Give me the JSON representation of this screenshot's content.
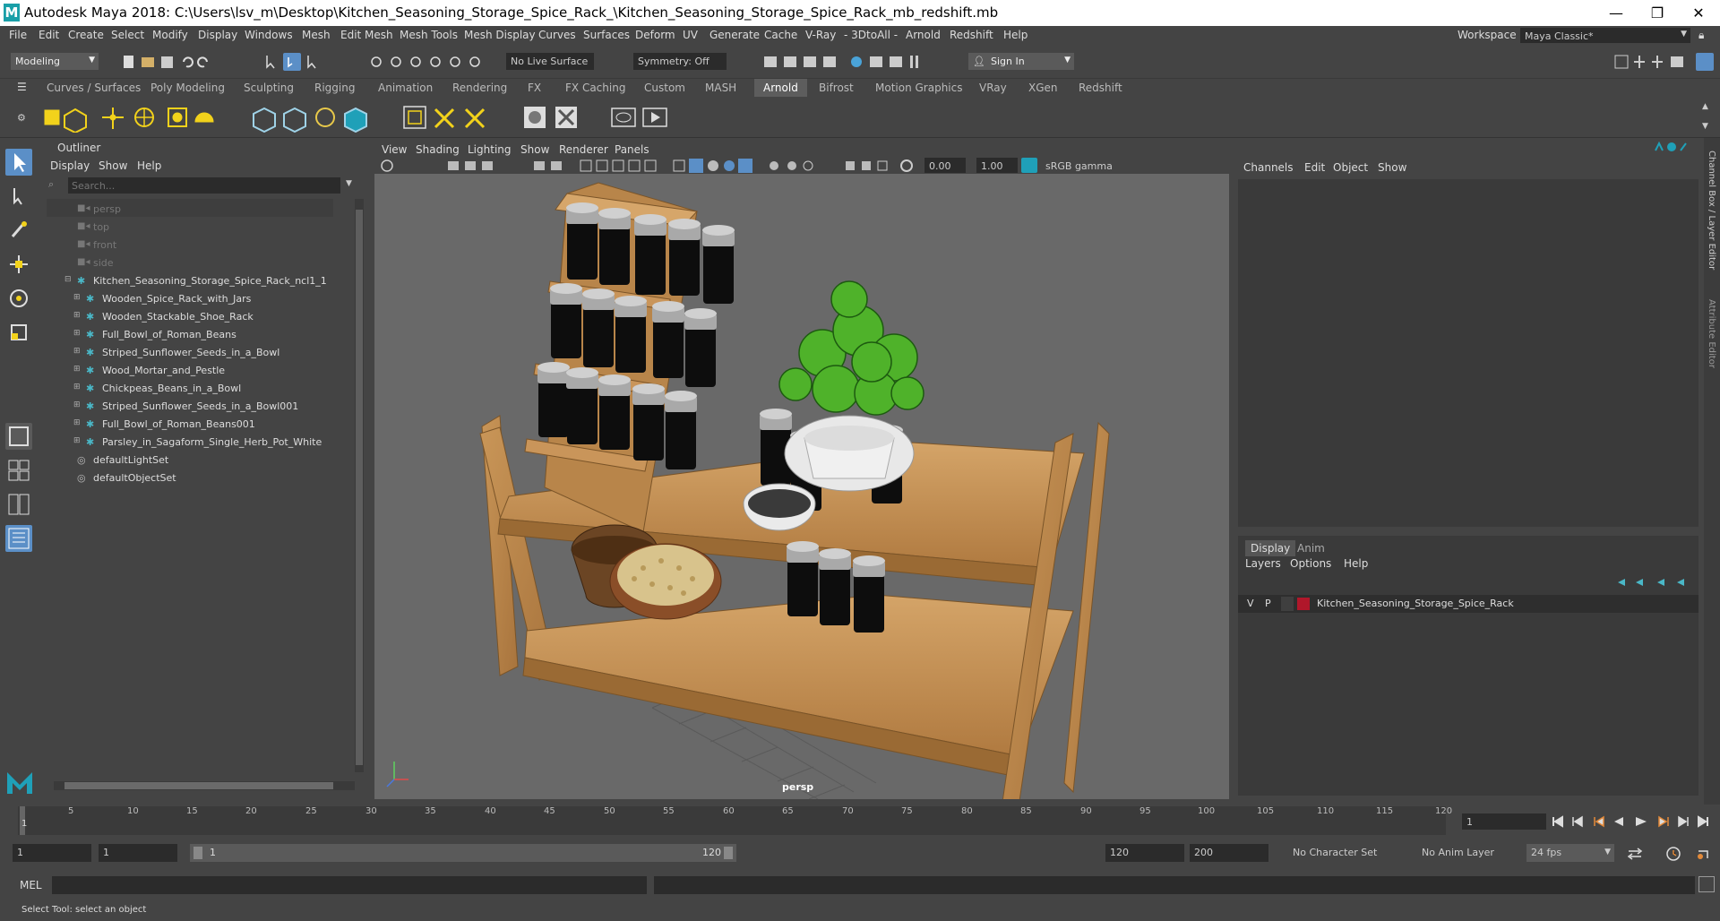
{
  "window": {
    "title": "Autodesk Maya 2018: C:\\Users\\lsv_m\\Desktop\\Kitchen_Seasoning_Storage_Spice_Rack_\\Kitchen_Seasoning_Storage_Spice_Rack_mb_redshift.mb",
    "logo": "M",
    "minimize": "—",
    "restore": "❐",
    "close": "✕"
  },
  "menubar": {
    "items": [
      "File",
      "Edit",
      "Create",
      "Select",
      "Modify",
      "Display",
      "Windows",
      "Mesh",
      "Edit Mesh",
      "Mesh Tools",
      "Mesh Display",
      "Curves",
      "Surfaces",
      "Deform",
      "UV",
      "Generate",
      "Cache",
      "V-Ray",
      "- 3DtoAll -",
      "Arnold",
      "Redshift",
      "Help"
    ],
    "workspace_label": "Workspace :",
    "workspace_value": "Maya Classic*"
  },
  "statusline": {
    "mode": "Modeling",
    "live_surface": "No Live Surface",
    "symmetry": "Symmetry: Off",
    "sign_in": "Sign In"
  },
  "shelf": {
    "tabs": [
      "Curves / Surfaces",
      "Poly Modeling",
      "Sculpting",
      "Rigging",
      "Animation",
      "Rendering",
      "FX",
      "FX Caching",
      "Custom",
      "MASH",
      "Arnold",
      "Bifrost",
      "Motion Graphics",
      "VRay",
      "XGen",
      "Redshift"
    ],
    "active_tab": "Arnold"
  },
  "outliner": {
    "title": "Outliner",
    "menu": [
      "Display",
      "Show",
      "Help"
    ],
    "search_placeholder": "Search...",
    "cameras": [
      "persp",
      "top",
      "front",
      "side"
    ],
    "root": "Kitchen_Seasoning_Storage_Spice_Rack_ncl1_1",
    "children": [
      "Wooden_Spice_Rack_with_Jars",
      "Wooden_Stackable_Shoe_Rack",
      "Full_Bowl_of_Roman_Beans",
      "Striped_Sunflower_Seeds_in_a_Bowl",
      "Wood_Mortar_and_Pestle",
      "Chickpeas_Beans_in_a_Bowl",
      "Striped_Sunflower_Seeds_in_a_Bowl001",
      "Full_Bowl_of_Roman_Beans001",
      "Parsley_in_Sagaform_Single_Herb_Pot_White"
    ],
    "sets": [
      "defaultLightSet",
      "defaultObjectSet"
    ]
  },
  "viewport": {
    "menu": [
      "View",
      "Shading",
      "Lighting",
      "Show",
      "Renderer",
      "Panels"
    ],
    "exposure": "0.00",
    "gamma": "1.00",
    "color_space": "sRGB gamma",
    "camera_label": "persp"
  },
  "channelbox": {
    "menu": [
      "Channels",
      "Edit",
      "Object",
      "Show"
    ],
    "side_tab_1": "Channel Box / Layer Editor",
    "side_tab_2": "Attribute Editor"
  },
  "layereditor": {
    "tabs": [
      "Display",
      "Anim"
    ],
    "menu": [
      "Layers",
      "Options",
      "Help"
    ],
    "layer": {
      "v": "V",
      "p": "P",
      "name": "Kitchen_Seasoning_Storage_Spice_Rack",
      "color": "#b0172a"
    }
  },
  "timeline": {
    "ticks": [
      "1",
      "5",
      "10",
      "15",
      "20",
      "25",
      "30",
      "35",
      "40",
      "45",
      "50",
      "55",
      "60",
      "65",
      "70",
      "75",
      "80",
      "85",
      "90",
      "95",
      "100",
      "105",
      "110",
      "115",
      "120"
    ],
    "current_frame": "1"
  },
  "range": {
    "start": "1",
    "inner_start": "1",
    "slider_start": "1",
    "slider_end": "120",
    "end": "120",
    "anim_end": "200",
    "character_set": "No Character Set",
    "anim_layer": "No Anim Layer",
    "fps": "24 fps"
  },
  "mel": {
    "label": "MEL"
  },
  "help": {
    "text": "Select Tool: select an object"
  }
}
